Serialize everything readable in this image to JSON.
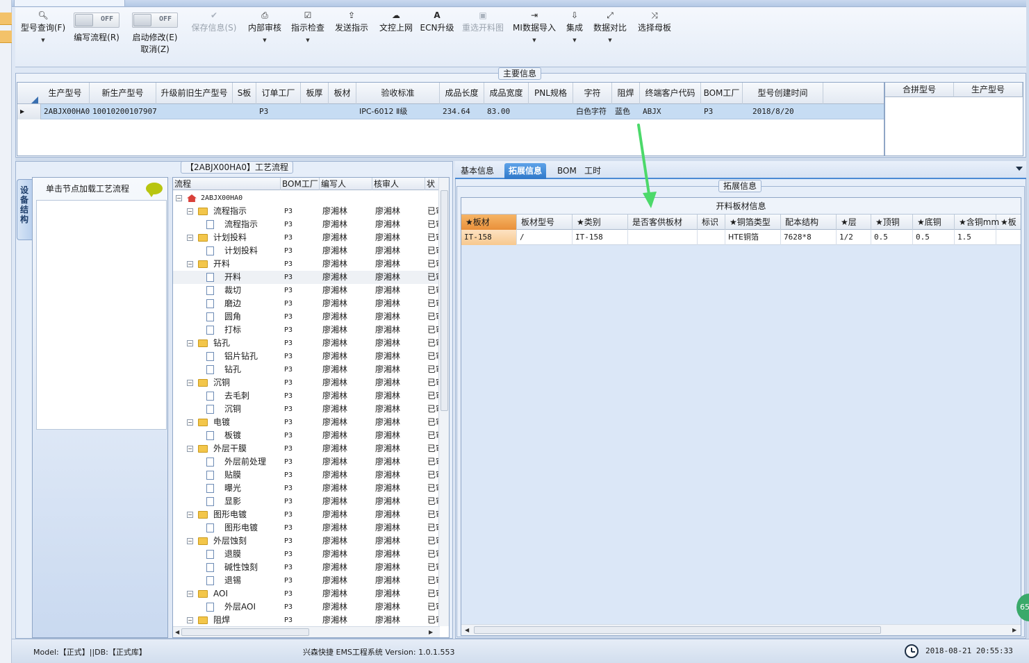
{
  "toolbar": {
    "model_query": "型号查询(F)",
    "write_flow": "编写流程(R)",
    "write_flow_toggle": "OFF",
    "start_modify": "启动修改(E)",
    "start_modify_cancel": "取消(Z)",
    "start_modify_toggle": "OFF",
    "save_info": "保存信息(S)",
    "internal_review": "内部审核",
    "instruction_check": "指示检查",
    "send_instruction": "发送指示",
    "doc_upload": "文控上网",
    "ecn_upgrade": "ECN升级",
    "reselect_cut_chart": "重选开料图",
    "mi_import": "MI数据导入",
    "integrate": "集成",
    "data_compare": "数据对比",
    "select_mother_board": "选择母板"
  },
  "main_info": {
    "title": "主要信息",
    "columns": [
      "生产型号",
      "新生产型号",
      "升级前旧生产型号",
      "S板",
      "订单工厂",
      "板厚",
      "板材",
      "验收标准",
      "成品长度",
      "成品宽度",
      "PNL规格",
      "字符",
      "阻焊",
      "终端客户代码",
      "BOM工厂",
      "型号创建时间"
    ],
    "row": [
      "2ABJX00HA0",
      "10010200107907",
      "",
      "",
      "P3",
      "",
      "",
      "IPC-6012 Ⅱ级",
      "234.64",
      "83.00",
      "",
      "白色字符",
      "蓝色",
      "ABJX",
      "P3",
      "2018/8/20"
    ],
    "merge_columns": [
      "合拼型号",
      "生产型号"
    ]
  },
  "left_panel": {
    "vertical_tab": "设备结构",
    "device_hint": "单击节点加载工艺流程",
    "flow_title": "【2ABJX00HA0】工艺流程",
    "flow_columns": [
      "流程",
      "BOM工厂",
      "编写人",
      "核审人",
      "状"
    ],
    "root": "2ABJX00HA0",
    "rows": [
      {
        "name": "流程指示",
        "level": 1,
        "factory": "P3",
        "writer": "廖湘林",
        "reviewer": "廖湘林",
        "status": "已审"
      },
      {
        "name": "流程指示",
        "level": 2,
        "factory": "P3",
        "writer": "廖湘林",
        "reviewer": "廖湘林",
        "status": "已审"
      },
      {
        "name": "计划投料",
        "level": 1,
        "factory": "P3",
        "writer": "廖湘林",
        "reviewer": "廖湘林",
        "status": "已审"
      },
      {
        "name": "计划投料",
        "level": 2,
        "factory": "P3",
        "writer": "廖湘林",
        "reviewer": "廖湘林",
        "status": "已审"
      },
      {
        "name": "开料",
        "level": 1,
        "factory": "P3",
        "writer": "廖湘林",
        "reviewer": "廖湘林",
        "status": "已审"
      },
      {
        "name": "开料",
        "level": 2,
        "factory": "P3",
        "writer": "廖湘林",
        "reviewer": "廖湘林",
        "status": "已审"
      },
      {
        "name": "裁切",
        "level": 2,
        "factory": "P3",
        "writer": "廖湘林",
        "reviewer": "廖湘林",
        "status": "已审"
      },
      {
        "name": "磨边",
        "level": 2,
        "factory": "P3",
        "writer": "廖湘林",
        "reviewer": "廖湘林",
        "status": "已审"
      },
      {
        "name": "圆角",
        "level": 2,
        "factory": "P3",
        "writer": "廖湘林",
        "reviewer": "廖湘林",
        "status": "已审"
      },
      {
        "name": "打标",
        "level": 2,
        "factory": "P3",
        "writer": "廖湘林",
        "reviewer": "廖湘林",
        "status": "已审"
      },
      {
        "name": "钻孔",
        "level": 1,
        "factory": "P3",
        "writer": "廖湘林",
        "reviewer": "廖湘林",
        "status": "已审"
      },
      {
        "name": "铝片钻孔",
        "level": 2,
        "factory": "P3",
        "writer": "廖湘林",
        "reviewer": "廖湘林",
        "status": "已审"
      },
      {
        "name": "钻孔",
        "level": 2,
        "factory": "P3",
        "writer": "廖湘林",
        "reviewer": "廖湘林",
        "status": "已审"
      },
      {
        "name": "沉铜",
        "level": 1,
        "factory": "P3",
        "writer": "廖湘林",
        "reviewer": "廖湘林",
        "status": "已审"
      },
      {
        "name": "去毛刺",
        "level": 2,
        "factory": "P3",
        "writer": "廖湘林",
        "reviewer": "廖湘林",
        "status": "已审"
      },
      {
        "name": "沉铜",
        "level": 2,
        "factory": "P3",
        "writer": "廖湘林",
        "reviewer": "廖湘林",
        "status": "已审"
      },
      {
        "name": "电镀",
        "level": 1,
        "factory": "P3",
        "writer": "廖湘林",
        "reviewer": "廖湘林",
        "status": "已审"
      },
      {
        "name": "板镀",
        "level": 2,
        "factory": "P3",
        "writer": "廖湘林",
        "reviewer": "廖湘林",
        "status": "已审"
      },
      {
        "name": "外层干膜",
        "level": 1,
        "factory": "P3",
        "writer": "廖湘林",
        "reviewer": "廖湘林",
        "status": "已审"
      },
      {
        "name": "外层前处理",
        "level": 2,
        "factory": "P3",
        "writer": "廖湘林",
        "reviewer": "廖湘林",
        "status": "已审"
      },
      {
        "name": "贴膜",
        "level": 2,
        "factory": "P3",
        "writer": "廖湘林",
        "reviewer": "廖湘林",
        "status": "已审"
      },
      {
        "name": "曝光",
        "level": 2,
        "factory": "P3",
        "writer": "廖湘林",
        "reviewer": "廖湘林",
        "status": "已审"
      },
      {
        "name": "显影",
        "level": 2,
        "factory": "P3",
        "writer": "廖湘林",
        "reviewer": "廖湘林",
        "status": "已审"
      },
      {
        "name": "图形电镀",
        "level": 1,
        "factory": "P3",
        "writer": "廖湘林",
        "reviewer": "廖湘林",
        "status": "已审"
      },
      {
        "name": "图形电镀",
        "level": 2,
        "factory": "P3",
        "writer": "廖湘林",
        "reviewer": "廖湘林",
        "status": "已审"
      },
      {
        "name": "外层蚀刻",
        "level": 1,
        "factory": "P3",
        "writer": "廖湘林",
        "reviewer": "廖湘林",
        "status": "已审"
      },
      {
        "name": "退膜",
        "level": 2,
        "factory": "P3",
        "writer": "廖湘林",
        "reviewer": "廖湘林",
        "status": "已审"
      },
      {
        "name": "碱性蚀刻",
        "level": 2,
        "factory": "P3",
        "writer": "廖湘林",
        "reviewer": "廖湘林",
        "status": "已审"
      },
      {
        "name": "退锡",
        "level": 2,
        "factory": "P3",
        "writer": "廖湘林",
        "reviewer": "廖湘林",
        "status": "已审"
      },
      {
        "name": "AOI",
        "level": 1,
        "factory": "P3",
        "writer": "廖湘林",
        "reviewer": "廖湘林",
        "status": "已审"
      },
      {
        "name": "外层AOI",
        "level": 2,
        "factory": "P3",
        "writer": "廖湘林",
        "reviewer": "廖湘林",
        "status": "已审"
      },
      {
        "name": "阻焊",
        "level": 1,
        "factory": "P3",
        "writer": "廖湘林",
        "reviewer": "廖湘林",
        "status": "已审"
      }
    ]
  },
  "right_panel": {
    "tabs": [
      "基本信息",
      "拓展信息",
      "BOM",
      "工时"
    ],
    "active_tab": "拓展信息",
    "group_title": "拓展信息",
    "grid_caption": "开料板材信息",
    "columns": [
      "★板材",
      "板材型号",
      "★类别",
      "是否客供板材",
      "标识",
      "★铜箔类型",
      "配本结构",
      "★层",
      "★顶铜",
      "★底铜",
      "★含铜mm",
      "★板"
    ],
    "row": [
      "IT-158",
      "/",
      "IT-158",
      "",
      "",
      "HTE铜箔",
      "7628*8",
      "1/2",
      "0.5",
      "0.5",
      "1.5",
      ""
    ]
  },
  "status": {
    "left": "Model:【正式】||DB:【正式库】",
    "center": "兴森快捷 EMS工程系统 Version: 1.0.1.553",
    "time": "2018-08-21 20:55:33",
    "badge": "65"
  },
  "colors": {
    "accent": "#2f78c9",
    "selected_row": "#c6dcf3",
    "arrow": "#4cd96a"
  }
}
